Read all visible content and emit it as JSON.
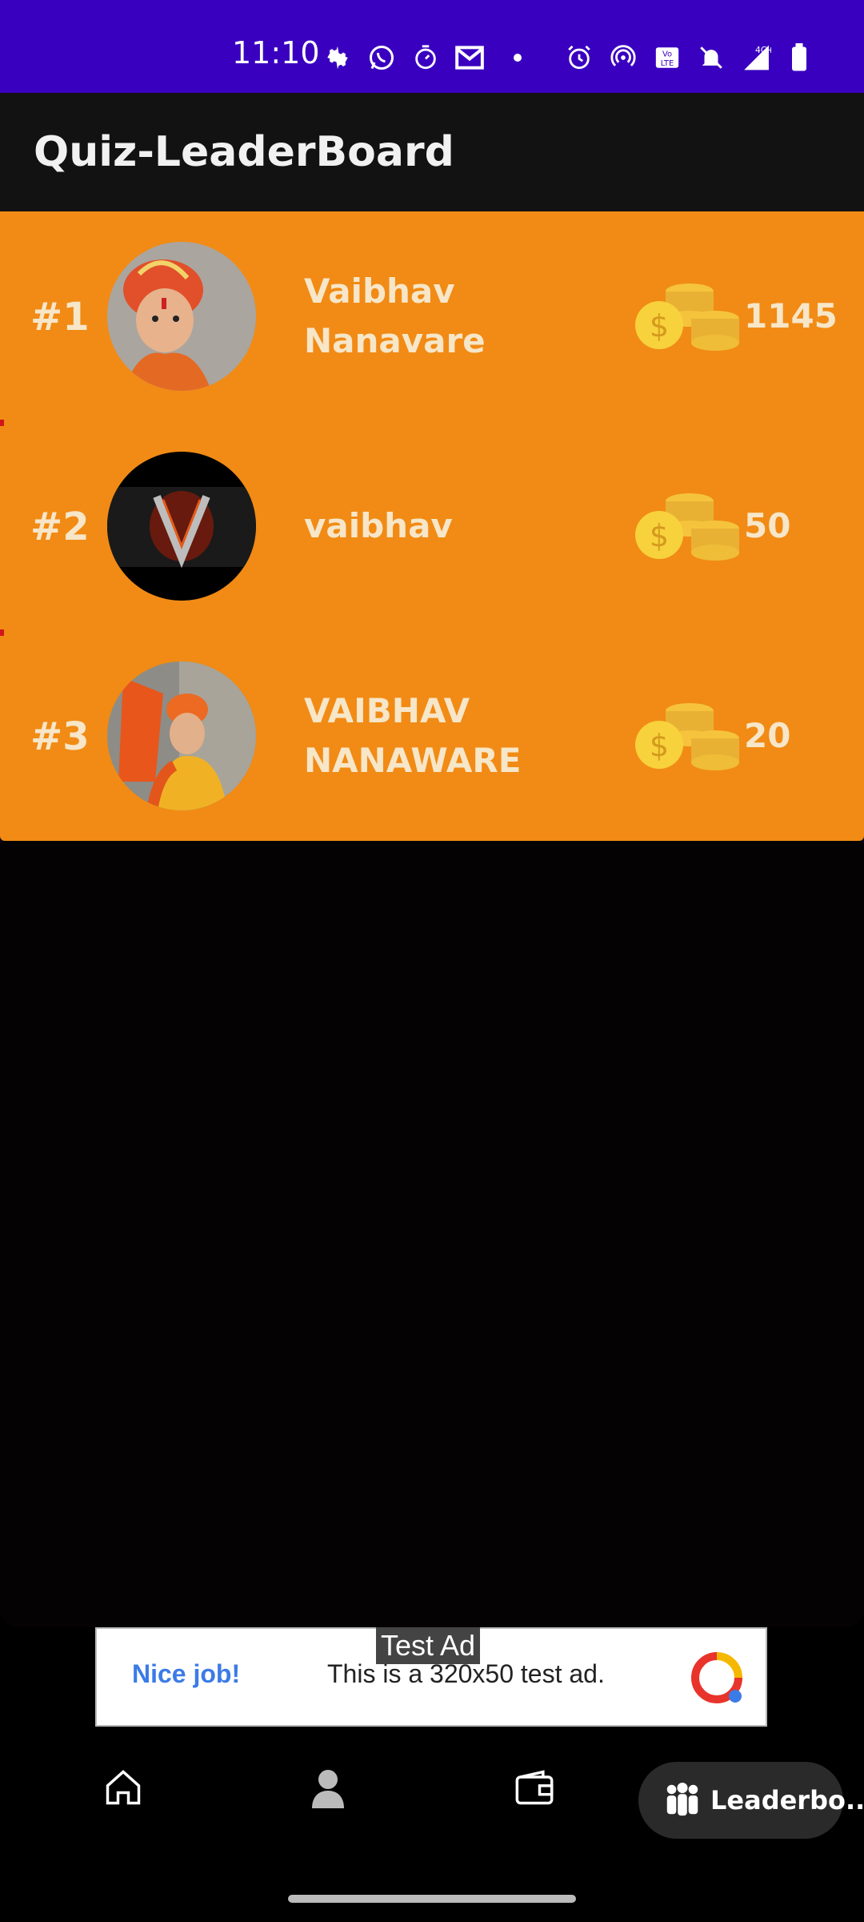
{
  "status_bar": {
    "time": "11:10",
    "bg_color": "#3a00c0",
    "icons": [
      "settings-icon",
      "whatsapp-icon",
      "timer-icon",
      "gmail-icon",
      "alarm-icon",
      "hotspot-icon",
      "volte-icon",
      "mute-icon",
      "signal-4g-icon",
      "battery-icon"
    ],
    "network_label": "4G+"
  },
  "app_bar": {
    "title": "Quiz-LeaderBoard"
  },
  "leaderboard": {
    "bg_color": "#f18b15",
    "entries": [
      {
        "rank": "#1",
        "name": "Vaibhav Nanavare",
        "score": "1145",
        "avatar": "profile-photo-orange-turban"
      },
      {
        "rank": "#2",
        "name": "vaibhav",
        "score": "50",
        "avatar": "letter-v-fire-logo"
      },
      {
        "rank": "#3",
        "name": "VAIBHAV NANAWARE",
        "score": "20",
        "avatar": "profile-photo-orange-flag"
      }
    ]
  },
  "ad": {
    "badge": "Test Ad",
    "cta": "Nice job!",
    "text": "This is a 320x50 test ad."
  },
  "bottom_nav": {
    "items": [
      "home-icon",
      "profile-icon",
      "wallet-icon"
    ],
    "active_label": "Leaderbo...",
    "active_icon": "group-icon"
  }
}
